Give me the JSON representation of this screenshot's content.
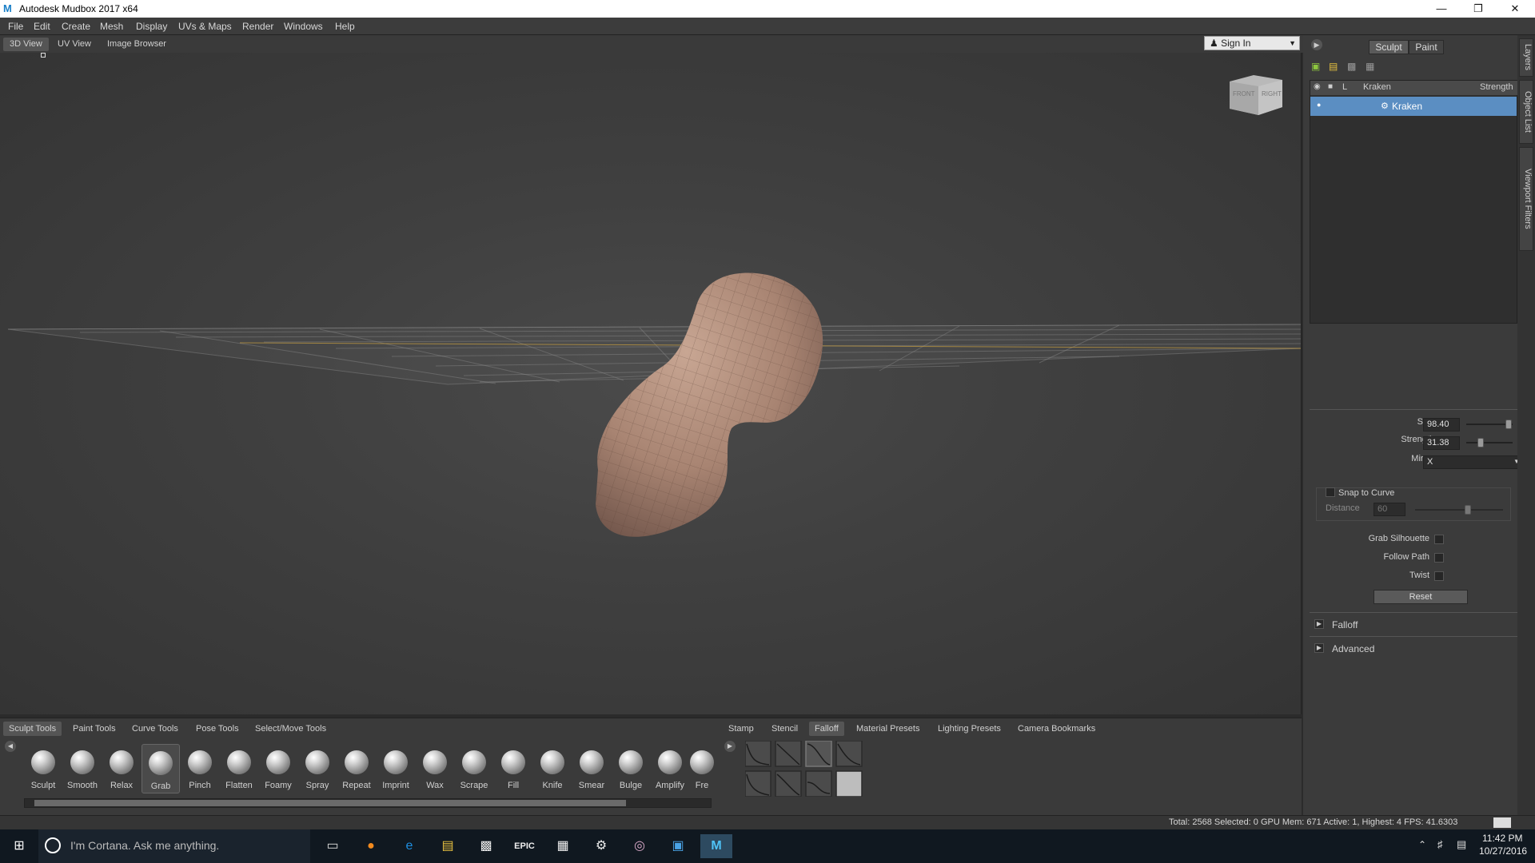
{
  "window": {
    "title": "Autodesk Mudbox 2017 x64",
    "app_letter": "M",
    "buttons": [
      "—",
      "❐",
      "✕"
    ]
  },
  "menu": [
    "File",
    "Edit",
    "Create",
    "Mesh",
    "Display",
    "UVs & Maps",
    "Render",
    "Windows",
    "Help"
  ],
  "view_tabs": [
    {
      "label": "3D View",
      "active": true
    },
    {
      "label": "UV View",
      "active": false
    },
    {
      "label": "Image Browser",
      "active": false
    }
  ],
  "sign_in": "Sign In",
  "nav_cube": {
    "front": "FRONT",
    "right": "RIGHT"
  },
  "mode_toggle": {
    "sculpt": "Sculpt",
    "paint": "Paint"
  },
  "side_tabs": [
    "Layers",
    "Object List",
    "Viewport Filters"
  ],
  "layers": {
    "header": {
      "l": "L",
      "name": "Kraken",
      "strength": "Strength"
    },
    "rows": [
      {
        "name": "Kraken",
        "selected": true
      }
    ]
  },
  "properties": {
    "size_label": "Size",
    "size_value": "98.40",
    "size_level": 0.92,
    "strength_label": "Strength",
    "strength_value": "31.38",
    "strength_level": 0.31,
    "mirror_label": "Mirror",
    "mirror_value": "X",
    "snap_to_curve": "Snap to Curve",
    "distance_label": "Distance",
    "distance_value": "60",
    "distance_level": 0.6,
    "grab_silhouette": "Grab Silhouette",
    "follow_path": "Follow Path",
    "twist": "Twist",
    "reset": "Reset",
    "falloff_section": "Falloff",
    "advanced_section": "Advanced"
  },
  "tray_tabs_left": [
    {
      "label": "Sculpt Tools",
      "active": true
    },
    {
      "label": "Paint Tools",
      "active": false
    },
    {
      "label": "Curve Tools",
      "active": false
    },
    {
      "label": "Pose Tools",
      "active": false
    },
    {
      "label": "Select/Move Tools",
      "active": false
    }
  ],
  "tray_tabs_right": [
    {
      "label": "Stamp",
      "active": false
    },
    {
      "label": "Stencil",
      "active": false
    },
    {
      "label": "Falloff",
      "active": true
    },
    {
      "label": "Material Presets",
      "active": false
    },
    {
      "label": "Lighting Presets",
      "active": false
    },
    {
      "label": "Camera Bookmarks",
      "active": false
    }
  ],
  "tools": [
    "Sculpt",
    "Smooth",
    "Relax",
    "Grab",
    "Pinch",
    "Flatten",
    "Foamy",
    "Spray",
    "Repeat",
    "Imprint",
    "Wax",
    "Scrape",
    "Fill",
    "Knife",
    "Smear",
    "Bulge",
    "Amplify",
    "Fre"
  ],
  "active_tool": "Grab",
  "status": "Total: 2568  Selected: 0 GPU Mem: 671  Active: 1, Highest: 4  FPS: 41.6303",
  "taskbar": {
    "cortana": "I'm Cortana. Ask me anything.",
    "time": "11:42 PM",
    "date": "10/27/2016",
    "epic": "EPIC"
  },
  "colors": {
    "accent": "#1a7fc7",
    "selected_row": "#5b8ec2",
    "mesh": "#a88472"
  }
}
